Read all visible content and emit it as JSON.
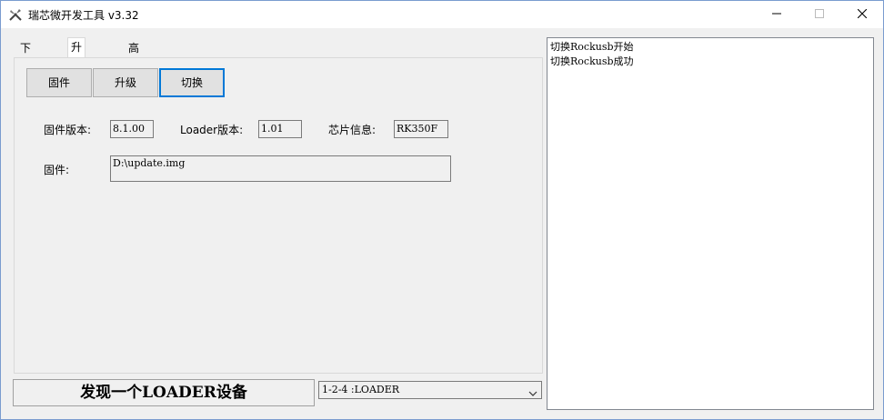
{
  "window": {
    "title": "瑞芯微开发工具 v3.32",
    "controls": {
      "minimize": "minimize-icon",
      "maximize": "maximize-icon",
      "close": "close-icon"
    }
  },
  "tabs": [
    {
      "label": "下载镜像",
      "active": false
    },
    {
      "label": "升级固件",
      "active": true
    },
    {
      "label": "高级功能",
      "active": false
    }
  ],
  "toolbar": {
    "firmware_label": "固件",
    "upgrade_label": "升级",
    "switch_label": "切换"
  },
  "info": {
    "fw_version_label": "固件版本:",
    "fw_version_value": "8.1.00",
    "loader_version_label": "Loader版本:",
    "loader_version_value": "1.01",
    "chip_label": "芯片信息:",
    "chip_value": "RK350F",
    "firmware_path_label": "固件:",
    "firmware_path_value": "D:\\update.img"
  },
  "log": [
    "切换Rockusb开始",
    "切换Rockusb成功"
  ],
  "status": {
    "text": "发现一个LOADER设备"
  },
  "device_select": {
    "selected": "1-2-4 :LOADER"
  },
  "colors": {
    "accent": "#0078d7",
    "background": "#f0f0f0"
  }
}
